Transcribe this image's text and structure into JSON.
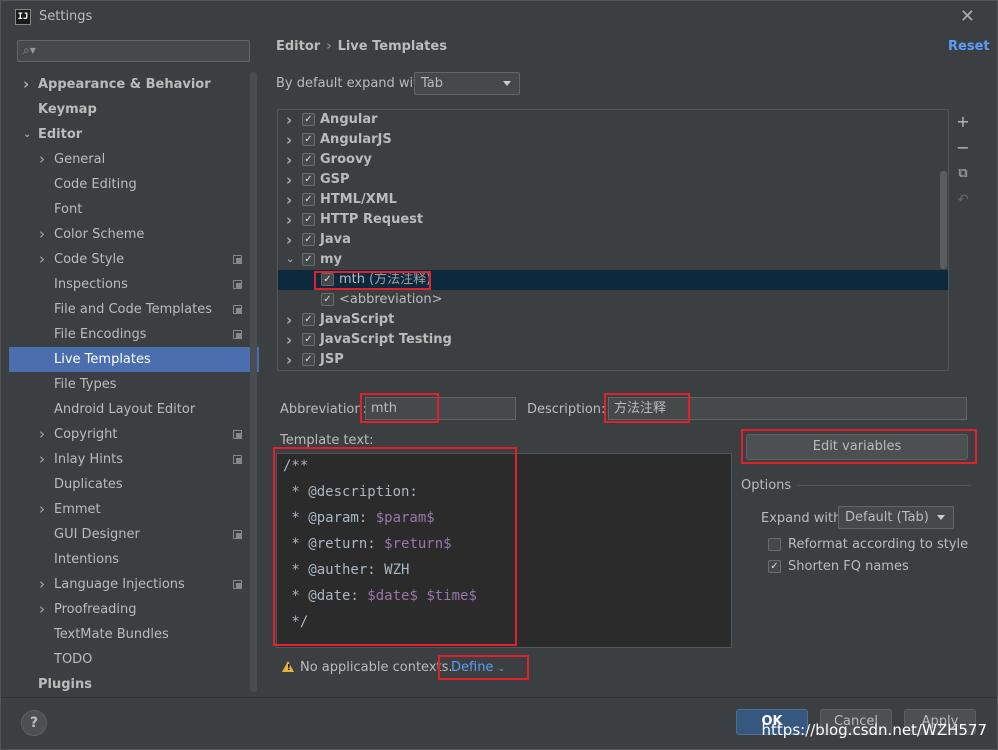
{
  "window": {
    "title": "Settings",
    "app_icon": "IJ"
  },
  "search": {
    "placeholder": ""
  },
  "sidebar": {
    "items": [
      {
        "label": "Appearance & Behavior",
        "level": 0,
        "arrow": "right",
        "bold": true
      },
      {
        "label": "Keymap",
        "level": 0,
        "arrow": "none",
        "bold": true
      },
      {
        "label": "Editor",
        "level": 0,
        "arrow": "down",
        "bold": true
      },
      {
        "label": "General",
        "level": 1,
        "arrow": "right"
      },
      {
        "label": "Code Editing",
        "level": 1,
        "arrow": "none"
      },
      {
        "label": "Font",
        "level": 1,
        "arrow": "none"
      },
      {
        "label": "Color Scheme",
        "level": 1,
        "arrow": "right"
      },
      {
        "label": "Code Style",
        "level": 1,
        "arrow": "right",
        "copy": true
      },
      {
        "label": "Inspections",
        "level": 1,
        "arrow": "none",
        "copy": true
      },
      {
        "label": "File and Code Templates",
        "level": 1,
        "arrow": "none",
        "copy": true
      },
      {
        "label": "File Encodings",
        "level": 1,
        "arrow": "none",
        "copy": true
      },
      {
        "label": "Live Templates",
        "level": 1,
        "arrow": "none",
        "selected": true
      },
      {
        "label": "File Types",
        "level": 1,
        "arrow": "none"
      },
      {
        "label": "Android Layout Editor",
        "level": 1,
        "arrow": "none"
      },
      {
        "label": "Copyright",
        "level": 1,
        "arrow": "right",
        "copy": true
      },
      {
        "label": "Inlay Hints",
        "level": 1,
        "arrow": "right",
        "copy": true
      },
      {
        "label": "Duplicates",
        "level": 1,
        "arrow": "none"
      },
      {
        "label": "Emmet",
        "level": 1,
        "arrow": "right"
      },
      {
        "label": "GUI Designer",
        "level": 1,
        "arrow": "none",
        "copy": true
      },
      {
        "label": "Intentions",
        "level": 1,
        "arrow": "none"
      },
      {
        "label": "Language Injections",
        "level": 1,
        "arrow": "right",
        "copy": true
      },
      {
        "label": "Proofreading",
        "level": 1,
        "arrow": "right"
      },
      {
        "label": "TextMate Bundles",
        "level": 1,
        "arrow": "none"
      },
      {
        "label": "TODO",
        "level": 1,
        "arrow": "none"
      },
      {
        "label": "Plugins",
        "level": 0,
        "arrow": "none",
        "bold": true
      }
    ]
  },
  "breadcrumb": {
    "parent": "Editor",
    "current": "Live Templates",
    "separator": "›"
  },
  "reset_label": "Reset",
  "expand": {
    "label": "By default expand with",
    "value": "Tab"
  },
  "template_groups": [
    {
      "label": "Angular",
      "expanded": false,
      "checked": true
    },
    {
      "label": "AngularJS",
      "expanded": false,
      "checked": true
    },
    {
      "label": "Groovy",
      "expanded": false,
      "checked": true
    },
    {
      "label": "GSP",
      "expanded": false,
      "checked": true
    },
    {
      "label": "HTML/XML",
      "expanded": false,
      "checked": true
    },
    {
      "label": "HTTP Request",
      "expanded": false,
      "checked": true
    },
    {
      "label": "Java",
      "expanded": false,
      "checked": true
    },
    {
      "label": "my",
      "expanded": true,
      "checked": true
    },
    {
      "label": "mth",
      "desc": "(方法注释)",
      "child": true,
      "checked": true,
      "selected": true
    },
    {
      "label": "<abbreviation>",
      "child": true,
      "checked": true
    },
    {
      "label": "JavaScript",
      "expanded": false,
      "checked": true
    },
    {
      "label": "JavaScript Testing",
      "expanded": false,
      "checked": true
    },
    {
      "label": "JSP",
      "expanded": false,
      "checked": true
    }
  ],
  "abbreviation": {
    "label": "Abbreviation:",
    "value": "mth"
  },
  "description": {
    "label": "Description:",
    "value": "方法注释"
  },
  "template_text": {
    "label": "Template text:",
    "lines": [
      [
        {
          "t": "/**"
        }
      ],
      [
        {
          "t": " * @description:"
        }
      ],
      [
        {
          "t": " * @param: "
        },
        {
          "t": "$param$",
          "var": true
        }
      ],
      [
        {
          "t": " * @return: "
        },
        {
          "t": "$return$",
          "var": true
        }
      ],
      [
        {
          "t": " * @auther: WZH"
        }
      ],
      [
        {
          "t": " * @date: "
        },
        {
          "t": "$date$",
          "var": true
        },
        {
          "t": " "
        },
        {
          "t": "$time$",
          "var": true
        }
      ],
      [
        {
          "t": " */"
        }
      ]
    ]
  },
  "edit_variables_label": "Edit variables",
  "options": {
    "title": "Options",
    "expand_with_label": "Expand with",
    "expand_with_value": "Default (Tab)",
    "reformat_label": "Reformat according to style",
    "reformat_checked": false,
    "shorten_label": "Shorten FQ names",
    "shorten_checked": true
  },
  "context": {
    "warning": "No applicable contexts.",
    "define_label": "Define"
  },
  "footer": {
    "help": "?",
    "ok": "OK",
    "cancel": "Cancel",
    "apply": "Apply"
  },
  "watermark": "https://blog.csdn.net/WZH577",
  "colors": {
    "accent": "#4b6eaf",
    "link": "#589df6",
    "highlight_box": "#e0212c",
    "variable": "#9876aa"
  }
}
